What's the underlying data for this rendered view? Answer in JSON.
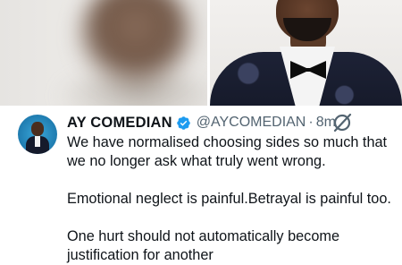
{
  "tweet": {
    "display_name": "AY COMEDIAN",
    "handle": "@AYCOMEDIAN",
    "separator": "·",
    "timestamp": "8m",
    "lines": [
      "We have normalised choosing sides so much that",
      "we no longer ask what truly went wrong.",
      "Emotional neglect is painful.Betrayal is painful too.",
      "One hurt should not automatically become",
      "justification for another"
    ],
    "verified_icon": "verified-badge-icon",
    "action_icon": "grok-icon",
    "accent_color": "#1d9bf0"
  }
}
